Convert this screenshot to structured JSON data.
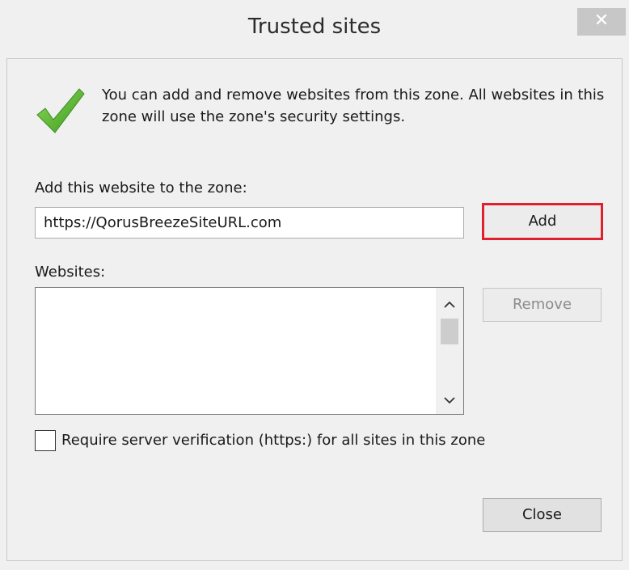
{
  "window": {
    "title": "Trusted sites",
    "close_glyph": "✕"
  },
  "intro": {
    "icon": "checkmark-icon",
    "text": "You can add and remove websites from this zone. All websites in this zone will use the zone's security settings."
  },
  "add_section": {
    "label": "Add this website to the zone:",
    "input_value": "https://QorusBreezeSiteURL.com",
    "add_label": "Add"
  },
  "websites": {
    "label": "Websites:",
    "items": [],
    "remove_label": "Remove",
    "scroll_up_glyph": "▲",
    "scroll_down_glyph": "▼"
  },
  "options": {
    "require_https_label": "Require server verification (https:) for all sites in this zone",
    "require_https_checked": false
  },
  "footer": {
    "close_label": "Close"
  },
  "colors": {
    "highlight": "#e0202e",
    "check_green": "#5cb82f"
  }
}
